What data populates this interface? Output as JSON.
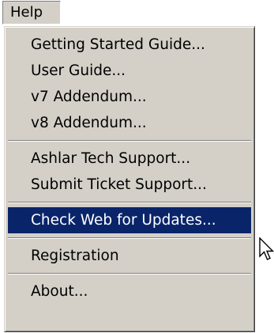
{
  "menubar": {
    "help_label": "Help"
  },
  "help_menu": {
    "group_docs": [
      "Getting Started Guide...",
      "User Guide...",
      "v7 Addendum...",
      "v8 Addendum..."
    ],
    "group_support": [
      "Ashlar Tech Support...",
      "Submit Ticket Support..."
    ],
    "check_updates": "Check Web for Updates...",
    "registration": "Registration",
    "about": "About..."
  },
  "colors": {
    "menu_face": "#d4d0c8",
    "highlight": "#0a246a",
    "highlight_text": "#ffffff"
  },
  "icons": {
    "pointer": "mouse-pointer-icon"
  }
}
